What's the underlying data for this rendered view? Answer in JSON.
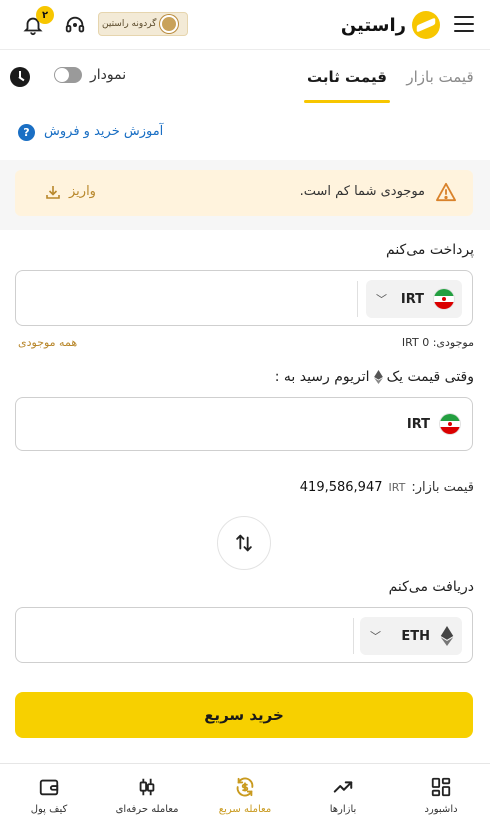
{
  "header": {
    "brand": "راستین",
    "wheel_label": "گردونه راستین",
    "notification_count": "۲"
  },
  "tabs": {
    "market_price": "قیمت بازار",
    "fixed_price": "قیمت ثابت",
    "chart_label": "نمودار"
  },
  "guide": {
    "link": "آموزش خرید و فروش",
    "help_glyph": "?"
  },
  "warning": {
    "text": "موجودی شما کم است.",
    "deposit": "واریز"
  },
  "pay": {
    "label": "پرداخت می‌کنم",
    "currency": "IRT",
    "chevron": "﹀",
    "balance_label": "موجودی:",
    "balance_unit": "IRT",
    "balance_value": "0",
    "all_balance": "همه موجودی"
  },
  "trigger": {
    "label_part1": "وقتی قیمت یک",
    "label_part2": "اتریوم رسید به :",
    "currency": "IRT"
  },
  "market": {
    "label": "قیمت بازار:",
    "unit": "IRT",
    "value": "419,586,947"
  },
  "receive": {
    "label": "دریافت می‌کنم",
    "currency": "ETH",
    "chevron": "﹀"
  },
  "buy_button": "خرید سریع",
  "nav": [
    {
      "label": "داشبورد",
      "icon": "dashboard-icon"
    },
    {
      "label": "بازارها",
      "icon": "markets-icon"
    },
    {
      "label": "معامله سریع",
      "icon": "quick-trade-icon"
    },
    {
      "label": "معامله حرفه‌ای",
      "icon": "pro-trade-icon"
    },
    {
      "label": "کیف پول",
      "icon": "wallet-icon"
    }
  ],
  "colors": {
    "accent": "#f7d000",
    "link": "#1a6fc4",
    "warning_bg": "#fff3dd",
    "active_nav": "#c99a1e"
  }
}
